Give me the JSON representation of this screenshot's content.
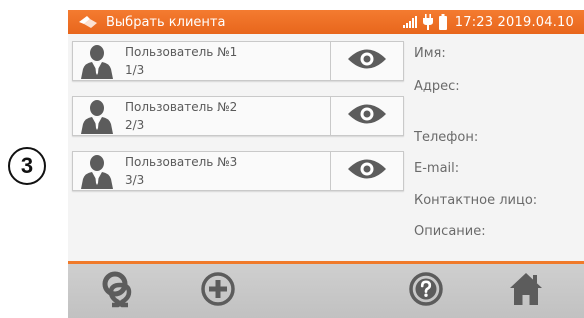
{
  "step_marker": "3",
  "status_bar": {
    "title": "Выбрать клиента",
    "time": "17:23 2019.04.10",
    "icons": [
      "clients-icon",
      "signal-icon",
      "plug-icon",
      "battery-icon"
    ]
  },
  "clients": [
    {
      "name": "Пользователь №1",
      "index": "1/3"
    },
    {
      "name": "Пользователь №2",
      "index": "2/3"
    },
    {
      "name": "Пользователь №3",
      "index": "3/3"
    }
  ],
  "details": {
    "name_label": "Имя:",
    "address_label": "Адрес:",
    "phone_label": "Телефон:",
    "email_label": "E-mail:",
    "contact_label": "Контактное лицо:",
    "description_label": "Описание:"
  },
  "toolbar": {
    "buttons": [
      "objects-icon",
      "add-icon",
      "help-icon",
      "home-icon"
    ]
  },
  "colors": {
    "accent": "#f07a2a",
    "toolbar_bg": "#c8c8c8",
    "icon": "#5c5c5c"
  }
}
